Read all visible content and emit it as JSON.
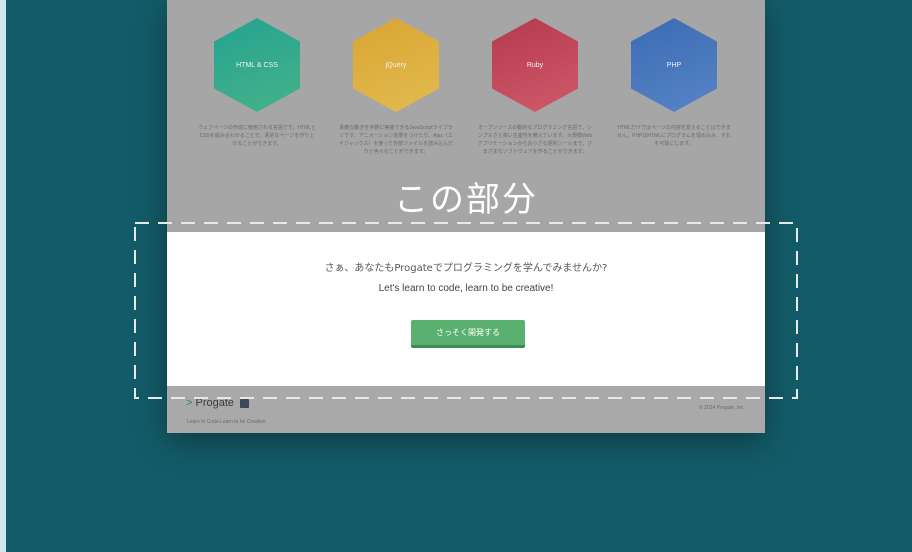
{
  "overlay_label": "この部分",
  "courses": [
    {
      "name": "HTML & CSS",
      "color_start": "#24a38f",
      "color_end": "#46b28a",
      "description": "ウェブページの作成に使用される言語です。HTMLとCSSを組み合わせることで、素的なページを作り上げることができます。"
    },
    {
      "name": "jQuery",
      "color_start": "#d9a532",
      "color_end": "#e2bb50",
      "description": "素敵な動きを手軽に実装できるJavaScriptライブラリです。アニメーション効果をつけたり、Ajax（エイジャックス）を使って外部ファイルを読み込んだりと色々なことができます。"
    },
    {
      "name": "Ruby",
      "color_start": "#b5394e",
      "color_end": "#cf5a6a",
      "description": "オープンソースの動的なプログラミング言語で、シンプルさと高い生産性を備えています。大規模Webアプリケーションからお小さな便利ツールまで、さまざまなソフトウェアを作ることができます。"
    },
    {
      "name": "PHP",
      "color_start": "#3b6bb3",
      "color_end": "#5784c6",
      "description": "HTMLだけではページの内容を変えることはできません。PHPはHTMLにプログラムを埋め込み、それを可能にします。"
    }
  ],
  "cta": {
    "line1": "さぁ、あなたもProgateでプログラミングを学んでみませんか?",
    "line2": "Let's learn to code, learn to be creative!",
    "button_label": "さっそく開発する"
  },
  "footer": {
    "logo_caret": ">",
    "logo_text": "Progate",
    "tagline": "Learn to Code.Learn to be Creative.",
    "copyright": "© 2014 Progate, Inc."
  },
  "colors": {
    "background": "#135b68",
    "cta_button": "#5ab06f",
    "overlay": "#a6a6a6"
  }
}
